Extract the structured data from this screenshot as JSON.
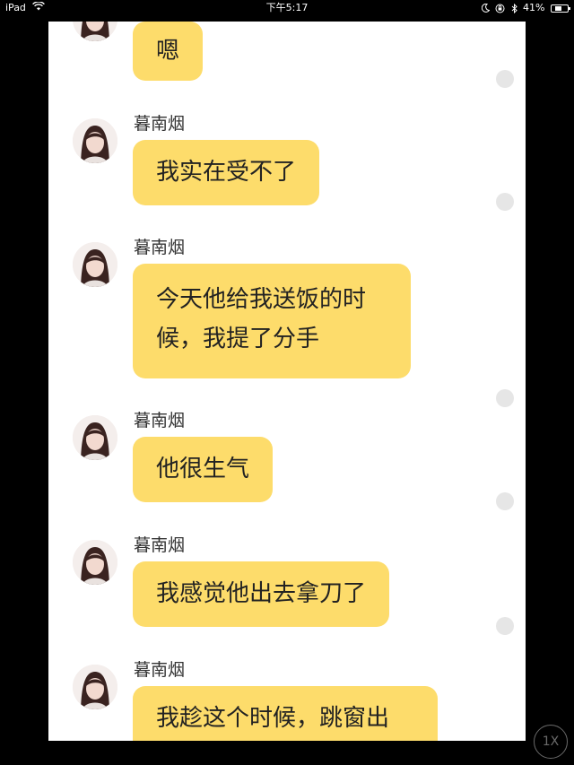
{
  "status_bar": {
    "device": "iPad",
    "time": "下午5:17",
    "battery_text": "41%",
    "battery_level": 0.41
  },
  "chat": {
    "messages": [
      {
        "sender": "",
        "text": "嗯"
      },
      {
        "sender": "暮南烟",
        "text": "我实在受不了"
      },
      {
        "sender": "暮南烟",
        "text": "今天他给我送饭的时候，我提了分手"
      },
      {
        "sender": "暮南烟",
        "text": "他很生气"
      },
      {
        "sender": "暮南烟",
        "text": "我感觉他出去拿刀了"
      },
      {
        "sender": "暮南烟",
        "text": "我趁这个时候，跳窗出"
      }
    ]
  },
  "playback": {
    "speed_label": "1X"
  },
  "icons": {
    "wifi": "wifi-icon",
    "moon": "moon-icon",
    "lock_rotation": "lock-rotation-icon",
    "bluetooth": "bluetooth-icon",
    "battery": "battery-icon"
  },
  "colors": {
    "bubble": "#fddc6b",
    "panel": "#ffffff",
    "background": "#000000",
    "read_dot": "#e6e6e6"
  }
}
